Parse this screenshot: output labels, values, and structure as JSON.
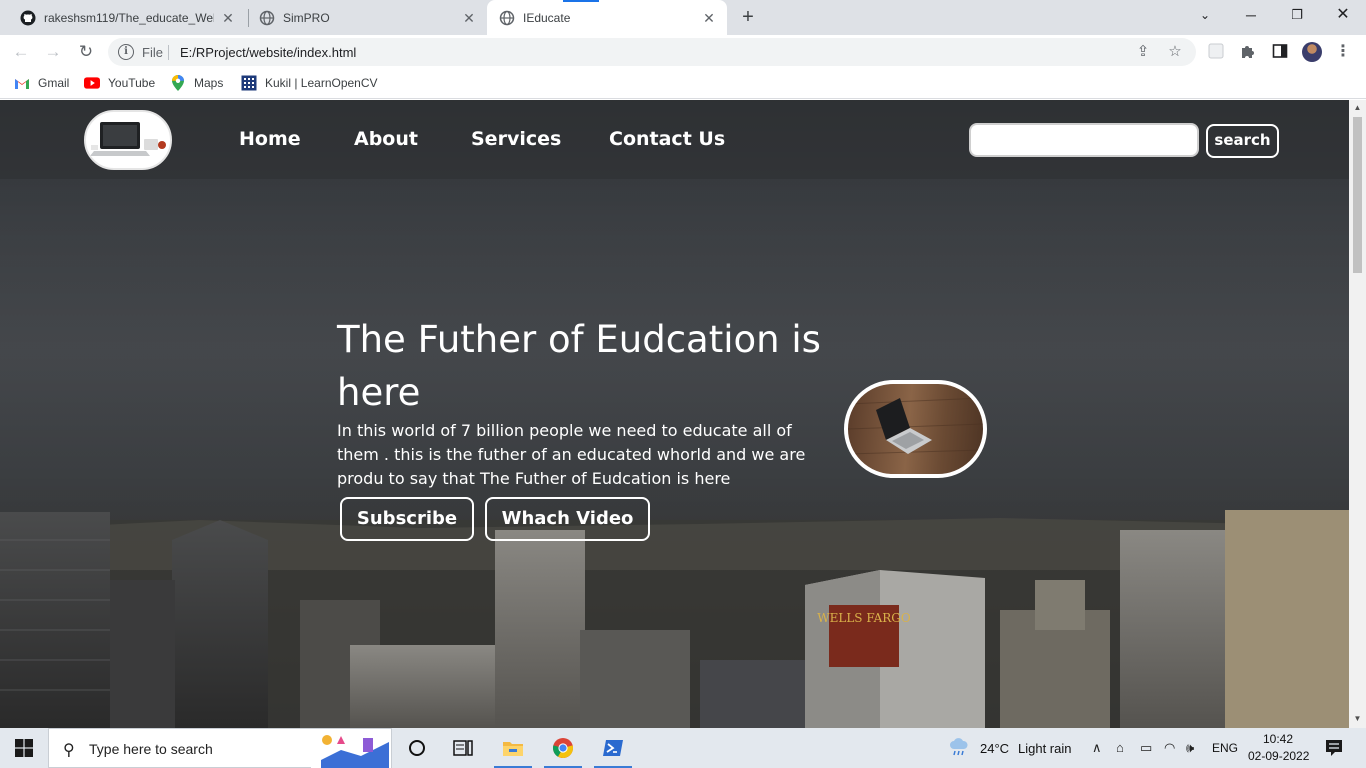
{
  "browser": {
    "tabs": [
      {
        "title": "rakeshsm119/The_educate_Webs",
        "icon": "github-icon"
      },
      {
        "title": "SimPRO",
        "icon": "globe-icon"
      },
      {
        "title": "IEducate",
        "icon": "globe-icon",
        "active": true
      }
    ],
    "address": {
      "scheme_label": "File",
      "url": "E:/RProject/website/index.html"
    },
    "bookmarks": [
      {
        "label": "Gmail",
        "icon": "gmail-icon"
      },
      {
        "label": "YouTube",
        "icon": "youtube-icon"
      },
      {
        "label": "Maps",
        "icon": "maps-icon"
      },
      {
        "label": "Kukil | LearnOpenCV",
        "icon": "learnopencv-icon"
      }
    ]
  },
  "page": {
    "nav": {
      "links": [
        "Home",
        "About",
        "Services",
        "Contact Us"
      ],
      "search_value": "",
      "search_button": "search"
    },
    "hero": {
      "title": "The Futher of Eudcation is here",
      "text": "In this world of 7 billion people we need to educate all of them . this is the futher of an educated whorld and we are produ to say that The Futher of Eudcation is here",
      "buttons": [
        "Subscribe",
        "Whach Video"
      ]
    },
    "background_sign": "WELLS FARGO"
  },
  "taskbar": {
    "search_placeholder": "Type here to search",
    "weather": {
      "temp": "24°C",
      "condition": "Light rain"
    },
    "language": "ENG",
    "time": "10:42",
    "date": "02-09-2022"
  },
  "colors": {
    "accent": "#1a73e8",
    "overlay": "#2d2f32"
  }
}
